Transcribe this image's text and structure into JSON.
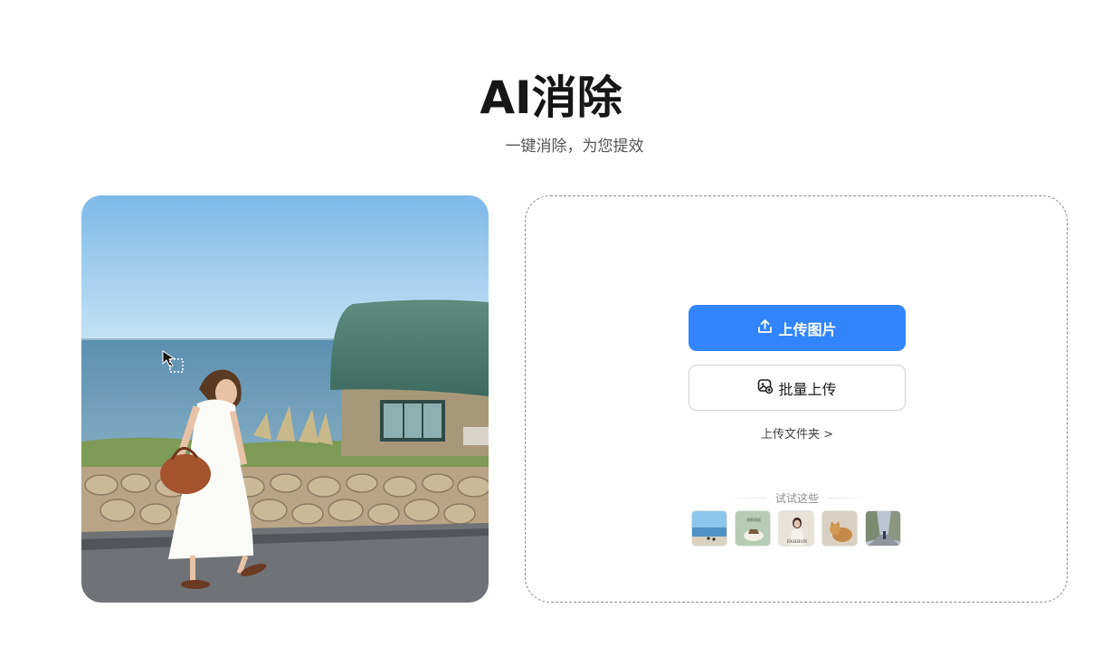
{
  "header": {
    "title": "AI消除",
    "subtitle": "一键消除，为您提效"
  },
  "demo_image": {
    "icon": "cursor-selection-icon"
  },
  "upload": {
    "primary_label": "上传图片",
    "primary_icon": "upload-icon",
    "secondary_label": "批量上传",
    "secondary_icon": "batch-image-icon",
    "folder_link": "上传文件夹 >",
    "try_label": "试试这些"
  },
  "samples": [
    {
      "name": "sample-seaside"
    },
    {
      "name": "sample-cake"
    },
    {
      "name": "sample-fashion-woman"
    },
    {
      "name": "sample-cat"
    },
    {
      "name": "sample-street"
    }
  ],
  "sample_text": {
    "green_card": "甜蜜蛋糕",
    "fashion": "FASHION"
  },
  "colors": {
    "accent": "#3385ff",
    "title": "#161616",
    "subtitle": "#555555"
  }
}
